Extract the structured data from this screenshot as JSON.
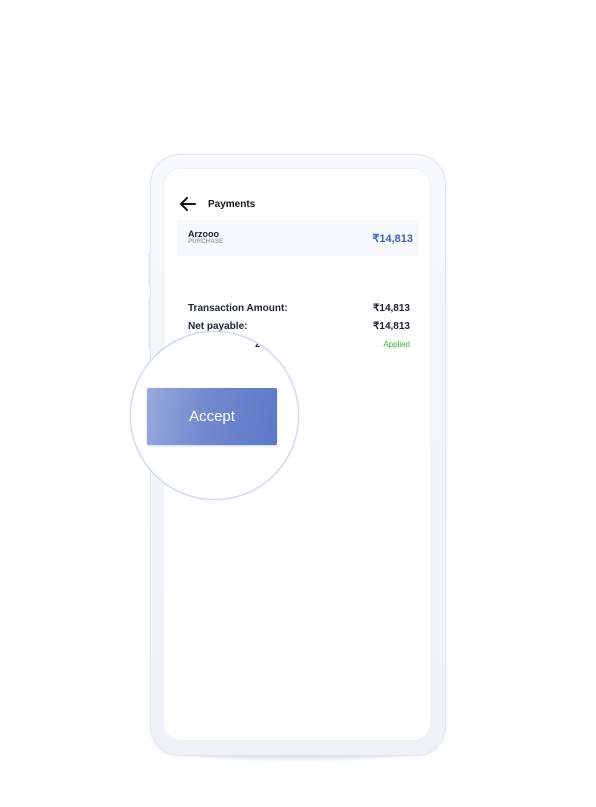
{
  "header": {
    "title": "Payments",
    "back_icon": "arrow-left-icon"
  },
  "merchant": {
    "name": "Arzooo",
    "type": "PURCHASE",
    "amount": "₹14,813"
  },
  "summary": {
    "transaction_amount": {
      "label": "Transaction Amount:",
      "value": "₹14,813"
    },
    "net_payable": {
      "label": "Net payable:",
      "value": "₹14,813"
    },
    "offer": {
      "label_fragment": "zooo:",
      "sub_fragment": "s",
      "status": "Applied"
    }
  },
  "action": {
    "accept_label": "Accept"
  },
  "colors": {
    "accent": "#3f63b4",
    "status_ok": "#3fae49",
    "button_start": "#98a9dc",
    "button_end": "#5d78c6"
  }
}
